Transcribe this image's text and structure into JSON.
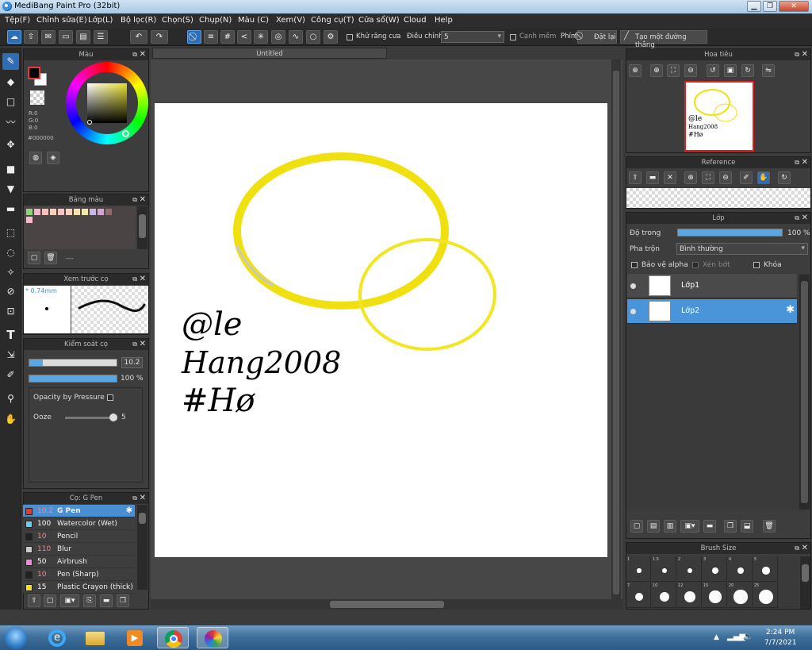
{
  "window": {
    "title": "MediBang Paint Pro (32bit)"
  },
  "menu": [
    "Tệp(F)",
    "Chỉnh sửa(E)",
    "Lớp(L)",
    "Bộ lọc(R)",
    "Chọn(S)",
    "Chụp(N)",
    "Màu (C)",
    "Xem(V)",
    "Công cụ(T)",
    "Cửa sổ(W)",
    "Cloud",
    "Help"
  ],
  "toolbar": {
    "antialias_label": "Khử răng cưa",
    "correction_label": "Điều chỉnh",
    "correction_value": "5",
    "soft_edge_label": "Cạnh mềm",
    "key_label": "Phím",
    "reset_label": "Đặt lại",
    "straight_line_label": "Tạo một đường thẳng"
  },
  "color_panel": {
    "title": "Màu",
    "r": "R:0",
    "g": "G:0",
    "b": "B:0",
    "hex": "#000000"
  },
  "palette_panel": {
    "title": "Bảng màu",
    "footer_text": "---",
    "swatches": [
      "#8fd17f",
      "#f7b3c7",
      "#f8c0b8",
      "#fbd0b5",
      "#f7c3c3",
      "#f9d2c2",
      "#f9e3a8",
      "#f4e8a6",
      "#c9b8e4",
      "#d9a3cf",
      "#8a6e6e",
      "#f4b8c8"
    ]
  },
  "preview_panel": {
    "title": "Xem trước cọ",
    "size_label": "* 0.74mm"
  },
  "brush_control": {
    "title": "Kiểm soát cọ",
    "size_value": "10.2",
    "opacity_value": "100 %",
    "opacity_by_pressure_label": "Opacity by Pressure",
    "ooze_label": "Ooze",
    "ooze_value": "5",
    "size_level": 0.15,
    "opacity_level": 1.0,
    "ooze_level": 1.0
  },
  "brush_panel": {
    "title": "Cọ: G Pen",
    "brushes": [
      {
        "color": "#e53935",
        "value": "10.2",
        "name": "G Pen",
        "selected": true
      },
      {
        "color": "#5fd3f0",
        "value": "100",
        "name": "Watercolor (Wet)"
      },
      {
        "color": "#222222",
        "value": "10",
        "name": "Pencil"
      },
      {
        "color": "#cccccc",
        "value": "110",
        "name": "Blur"
      },
      {
        "color": "#f08ad8",
        "value": "50",
        "name": "Airbrush"
      },
      {
        "color": "#222222",
        "value": "10",
        "name": "Pen (Sharp)"
      },
      {
        "color": "#f0e020",
        "value": "15",
        "name": "Plastic Crayon (thick)"
      }
    ]
  },
  "canvas": {
    "tab_title": "Untitled",
    "handwriting": [
      "@le",
      "Hang2008",
      "#Hø"
    ]
  },
  "navigator": {
    "title": "Hoa tiêu"
  },
  "reference": {
    "title": "Reference"
  },
  "layers": {
    "title": "Lớp",
    "opacity_label": "Độ trong",
    "opacity_value": "100 %",
    "opacity_level": 1.0,
    "blend_label": "Pha trộn",
    "blend_value": "Bình thường",
    "protect_alpha_label": "Bảo vệ alpha",
    "clipping_label": "Xén bớt",
    "lock_label": "Khóa",
    "items": [
      {
        "name": "Lớp1",
        "selected": false
      },
      {
        "name": "Lớp2",
        "selected": true
      }
    ]
  },
  "brush_size": {
    "title": "Brush Size",
    "sizes": [
      "1",
      "1.5",
      "2",
      "3",
      "4",
      "5",
      "7",
      "10",
      "12",
      "15",
      "20",
      "25"
    ]
  },
  "taskbar": {
    "time": "2:24 PM",
    "date": "7/7/2021"
  }
}
